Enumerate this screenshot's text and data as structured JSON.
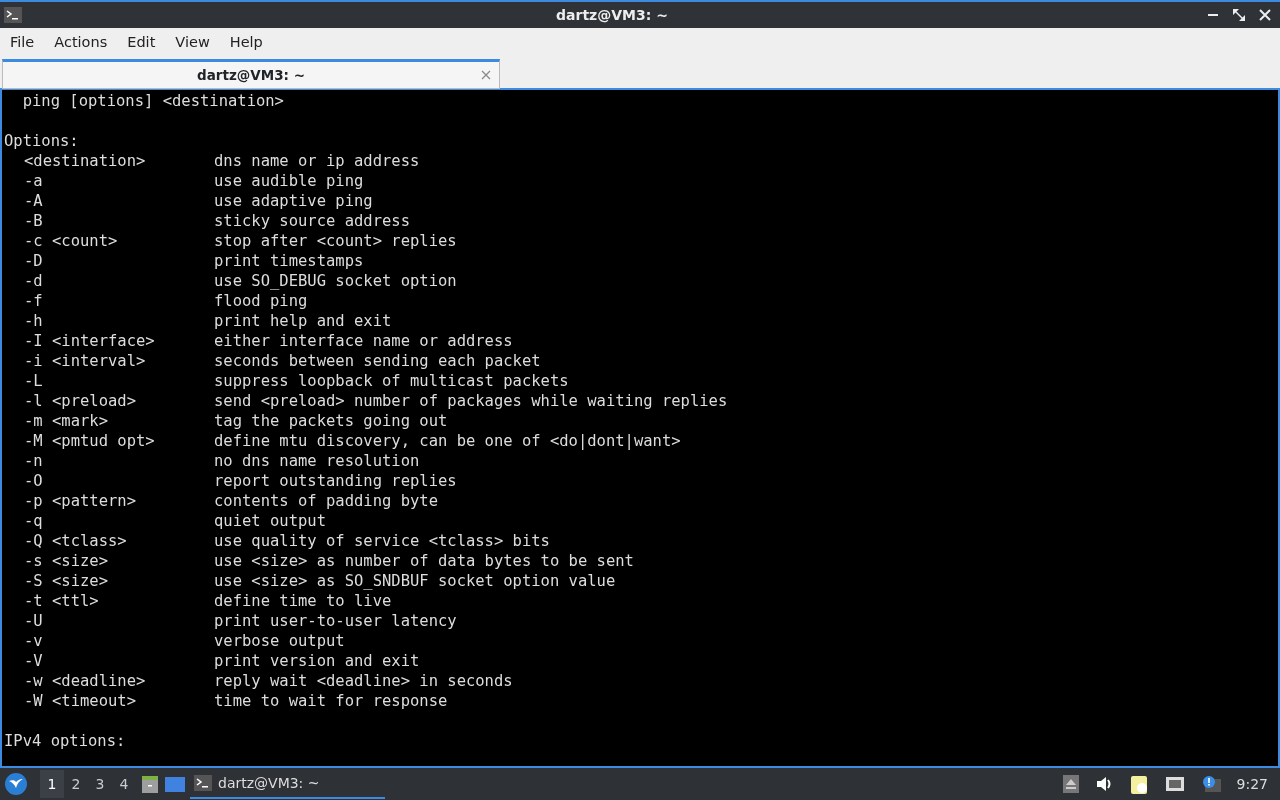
{
  "window": {
    "title": "dartz@VM3: ~"
  },
  "menu": [
    "File",
    "Actions",
    "Edit",
    "View",
    "Help"
  ],
  "tabs": [
    {
      "label": "dartz@VM3: ~",
      "selected": true
    }
  ],
  "terminal": {
    "usage": "  ping [options] <destination>",
    "options_heading": "Options:",
    "options": [
      {
        "flag": "<destination>",
        "description": "dns name or ip address"
      },
      {
        "flag": "-a",
        "description": "use audible ping"
      },
      {
        "flag": "-A",
        "description": "use adaptive ping"
      },
      {
        "flag": "-B",
        "description": "sticky source address"
      },
      {
        "flag": "-c <count>",
        "description": "stop after <count> replies"
      },
      {
        "flag": "-D",
        "description": "print timestamps"
      },
      {
        "flag": "-d",
        "description": "use SO_DEBUG socket option"
      },
      {
        "flag": "-f",
        "description": "flood ping"
      },
      {
        "flag": "-h",
        "description": "print help and exit"
      },
      {
        "flag": "-I <interface>",
        "description": "either interface name or address"
      },
      {
        "flag": "-i <interval>",
        "description": "seconds between sending each packet"
      },
      {
        "flag": "-L",
        "description": "suppress loopback of multicast packets"
      },
      {
        "flag": "-l <preload>",
        "description": "send <preload> number of packages while waiting replies"
      },
      {
        "flag": "-m <mark>",
        "description": "tag the packets going out"
      },
      {
        "flag": "-M <pmtud opt>",
        "description": "define mtu discovery, can be one of <do|dont|want>"
      },
      {
        "flag": "-n",
        "description": "no dns name resolution"
      },
      {
        "flag": "-O",
        "description": "report outstanding replies"
      },
      {
        "flag": "-p <pattern>",
        "description": "contents of padding byte"
      },
      {
        "flag": "-q",
        "description": "quiet output"
      },
      {
        "flag": "-Q <tclass>",
        "description": "use quality of service <tclass> bits"
      },
      {
        "flag": "-s <size>",
        "description": "use <size> as number of data bytes to be sent"
      },
      {
        "flag": "-S <size>",
        "description": "use <size> as SO_SNDBUF socket option value"
      },
      {
        "flag": "-t <ttl>",
        "description": "define time to live"
      },
      {
        "flag": "-U",
        "description": "print user-to-user latency"
      },
      {
        "flag": "-v",
        "description": "verbose output"
      },
      {
        "flag": "-V",
        "description": "print version and exit"
      },
      {
        "flag": "-w <deadline>",
        "description": "reply wait <deadline> in seconds"
      },
      {
        "flag": "-W <timeout>",
        "description": "time to wait for response"
      }
    ],
    "ipv4_heading": "IPv4 options:"
  },
  "taskbar": {
    "workspaces": [
      {
        "label": "1",
        "selected": true
      },
      {
        "label": "2",
        "selected": false
      },
      {
        "label": "3",
        "selected": false
      },
      {
        "label": "4",
        "selected": false
      }
    ],
    "tasks": [
      {
        "label": "dartz@VM3: ~",
        "selected": true
      }
    ],
    "clock": "9:27"
  }
}
